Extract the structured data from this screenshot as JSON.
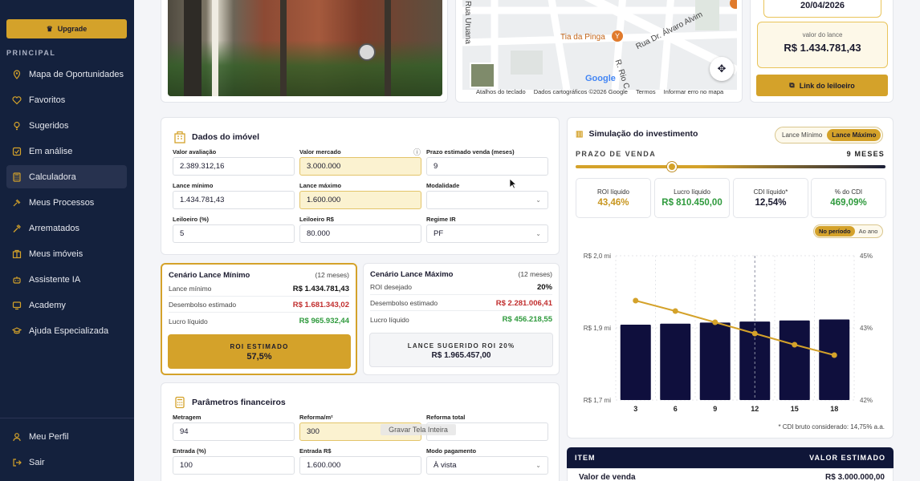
{
  "sidebar": {
    "upgrade_label": "Upgrade",
    "section_label": "PRINCIPAL",
    "items": [
      {
        "label": "Mapa de Oportunidades",
        "icon": "map-pin-icon"
      },
      {
        "label": "Favoritos",
        "icon": "heart-icon"
      },
      {
        "label": "Sugeridos",
        "icon": "lightbulb-icon"
      },
      {
        "label": "Em análise",
        "icon": "checkbox-icon"
      },
      {
        "label": "Calculadora",
        "icon": "calculator-icon",
        "active": true
      },
      {
        "label": "Meus Processos",
        "icon": "gavel-icon"
      },
      {
        "label": "Arrematados",
        "icon": "hammer-icon"
      },
      {
        "label": "Meus imóveis",
        "icon": "building-icon"
      },
      {
        "label": "Assistente IA",
        "icon": "robot-icon"
      },
      {
        "label": "Academy",
        "icon": "monitor-icon"
      },
      {
        "label": "Ajuda Especializada",
        "icon": "graduation-cap-icon"
      }
    ],
    "bottom": [
      {
        "label": "Meu Perfil",
        "icon": "user-icon"
      },
      {
        "label": "Sair",
        "icon": "logout-icon"
      }
    ]
  },
  "map": {
    "streets": [
      "Rua Uruana",
      "Rua Dr. Álvaro Alvim",
      "R. Rio C"
    ],
    "poi": "Tia da Pinga",
    "logo": "Google",
    "footer": [
      "Atalhos do teclado",
      "Dados cartográficos ©2026 Google",
      "Termos",
      "Informar erro no mapa"
    ]
  },
  "auction": {
    "date": "20/04/2026",
    "lance_label": "valor do lance",
    "lance_value": "R$ 1.434.781,43",
    "link_label": "Link do leiloeiro"
  },
  "dados": {
    "title": "Dados do imóvel",
    "fields": {
      "valor_avaliacao": {
        "label": "Valor avaliação",
        "value": "2.389.312,16"
      },
      "valor_mercado": {
        "label": "Valor mercado",
        "value": "3.000.000"
      },
      "prazo": {
        "label": "Prazo estimado venda (meses)",
        "value": "9"
      },
      "lance_minimo": {
        "label": "Lance mínimo",
        "value": "1.434.781,43"
      },
      "lance_maximo": {
        "label": "Lance máximo",
        "value": "1.600.000"
      },
      "modalidade": {
        "label": "Modalidade",
        "value": ""
      },
      "leiloeiro_pct": {
        "label": "Leiloeiro (%)",
        "value": "5"
      },
      "leiloeiro_rs": {
        "label": "Leiloeiro R$",
        "value": "80.000"
      },
      "regime_ir": {
        "label": "Regime IR",
        "value": "PF"
      }
    }
  },
  "cenario_min": {
    "title": "Cenário Lance Mínimo",
    "months": "(12 meses)",
    "rows": [
      {
        "label": "Lance mínimo",
        "value": "R$ 1.434.781,43"
      },
      {
        "label": "Desembolso estimado",
        "value": "R$ 1.681.343,02"
      },
      {
        "label": "Lucro líquido",
        "value": "R$ 965.932,44"
      }
    ],
    "roi_label": "ROI ESTIMADO",
    "roi_value": "57,5%"
  },
  "cenario_max": {
    "title": "Cenário Lance Máximo",
    "months": "(12 meses)",
    "rows": [
      {
        "label": "ROI desejado",
        "value": "20%"
      },
      {
        "label": "Desembolso estimado",
        "value": "R$ 2.281.006,41"
      },
      {
        "label": "Lucro líquido",
        "value": "R$ 456.218,55"
      }
    ],
    "sug_label": "LANCE SUGERIDO ROI 20%",
    "sug_value": "R$ 1.965.457,00"
  },
  "params": {
    "title": "Parâmetros financeiros",
    "fields": {
      "metragem": {
        "label": "Metragem",
        "value": "94"
      },
      "reforma_m2": {
        "label": "Reforma/m²",
        "value": "300"
      },
      "reforma_total": {
        "label": "Reforma total",
        "value": ""
      },
      "entrada_pct": {
        "label": "Entrada (%)",
        "value": "100"
      },
      "entrada_rs": {
        "label": "Entrada R$",
        "value": "1.600.000"
      },
      "modo_pagamento": {
        "label": "Modo pagamento",
        "value": "À vista"
      }
    }
  },
  "sim": {
    "title": "Simulação do investimento",
    "toggle": [
      "Lance Mínimo",
      "Lance Máximo"
    ],
    "prazo_label": "PRAZO DE VENDA",
    "prazo_value": "9 MESES",
    "slider_fraction": 0.31,
    "kpis": [
      {
        "label": "ROI líquido",
        "value": "43,46%",
        "color": "#c8961f"
      },
      {
        "label": "Lucro líquido",
        "value": "R$ 810.450,00",
        "color": "#2f9a3d"
      },
      {
        "label": "CDI líquido*",
        "value": "12,54%",
        "color": "#111111"
      },
      {
        "label": "% do CDI",
        "value": "469,09%",
        "color": "#2f9a3d"
      }
    ],
    "period_toggle": [
      "No período",
      "Ao ano"
    ],
    "footnote": "* CDI bruto considerado: 14,75% a.a."
  },
  "chart_data": {
    "type": "bar",
    "categories": [
      "3",
      "6",
      "9",
      "12",
      "15",
      "18"
    ],
    "series": [
      {
        "type": "bar",
        "axis": "left",
        "color": "#0f0f3d",
        "values": [
          1.87,
          1.872,
          1.874,
          1.876,
          1.878,
          1.881
        ]
      },
      {
        "type": "line",
        "axis": "right",
        "color": "#d4a22a",
        "values": [
          44.4,
          43.95,
          43.46,
          42.95,
          42.45,
          41.95
        ]
      }
    ],
    "left_ticks": [
      "R$ 1,7 mi",
      "R$ 1,9 mi",
      "R$ 2,0 mi"
    ],
    "right_ticks": [
      "42%",
      "43%",
      "45%"
    ],
    "ylim_left": [
      1.6,
      2.0
    ],
    "ylim_right": [
      41,
      46
    ],
    "highlight_category": "12"
  },
  "table": {
    "headers": [
      "ITEM",
      "VALOR ESTIMADO"
    ],
    "rows": [
      {
        "item": "Valor de venda",
        "value": "R$ 3.000.000,00"
      }
    ]
  },
  "tooltip": "Gravar Tela Inteira"
}
